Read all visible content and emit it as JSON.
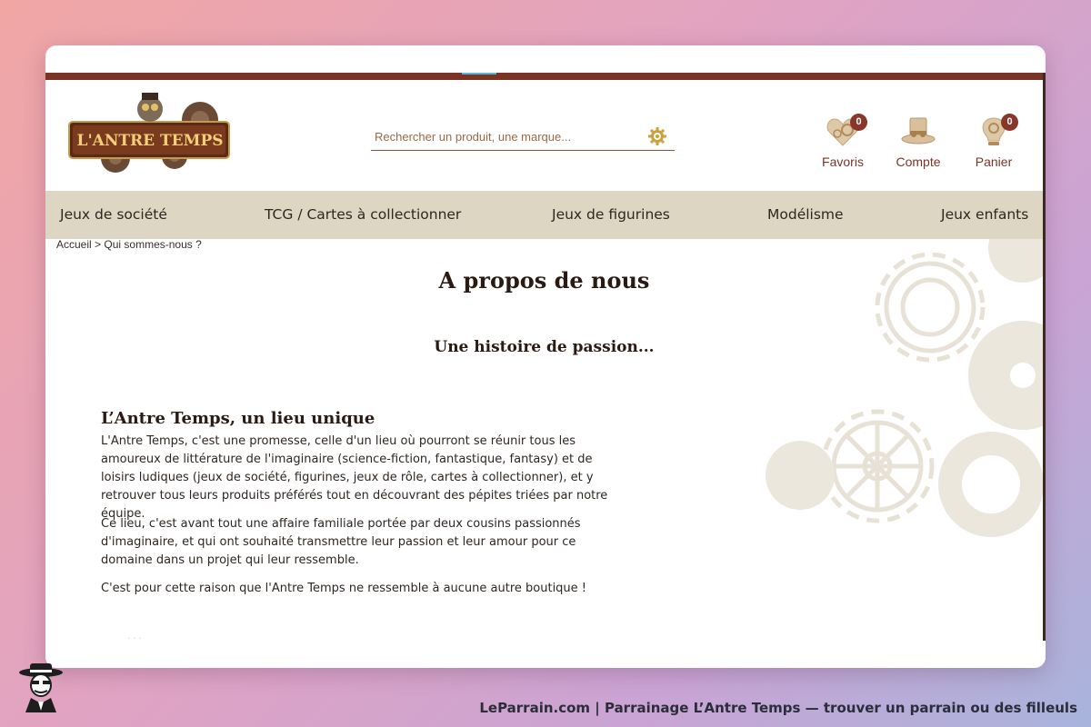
{
  "site": {
    "logo_text": "L'ANTRE TEMPS",
    "search": {
      "placeholder": "Rechercher un produit, une marque..."
    },
    "header_icons": [
      {
        "name": "favorites",
        "label": "Favoris",
        "badge": "0",
        "icon": "heart-gear-icon"
      },
      {
        "name": "account",
        "label": "Compte",
        "badge": null,
        "icon": "top-hat-icon"
      },
      {
        "name": "cart",
        "label": "Panier",
        "badge": "0",
        "icon": "lightbulb-gear-icon"
      }
    ],
    "nav": [
      "Jeux de société",
      "TCG / Cartes à collectionner",
      "Jeux de figurines",
      "Modélisme",
      "Jeux enfants"
    ],
    "breadcrumb": {
      "home": "Accueil",
      "separator": ">",
      "current": "Qui sommes-nous ?"
    }
  },
  "content": {
    "title": "A propos de nous",
    "subtitle": "Une histoire de passion...",
    "section_title": "L’Antre Temps, un lieu unique",
    "paragraphs": [
      "L'Antre Temps, c'est une promesse, celle d'un lieu où pourront se réunir tous les amoureux de littérature de l'imaginaire (science-fiction, fantastique, fantasy) et de loisirs ludiques (jeux de société, figurines, jeux de rôle, cartes à collectionner), et y retrouver tous leurs produits préférés tout en découvrant des pépites triées par notre équipe.",
      "Ce lieu, c'est avant tout une affaire familiale portée par deux cousins passionnés d'imaginaire, et qui ont souhaité transmettre leur passion et leur amour pour ce domaine dans un projet qui leur ressemble.",
      "C'est pour cette raison que l'Antre Temps ne ressemble à aucune autre boutique !"
    ]
  },
  "footer": {
    "caption": "LeParrain.com | Parrainage L’Antre Temps — trouver un parrain ou des filleuls"
  },
  "colors": {
    "accent": "#7a3426",
    "nav_bg": "#ddd6c2",
    "badge": "#8a3628",
    "text_dark": "#2a1a12"
  }
}
